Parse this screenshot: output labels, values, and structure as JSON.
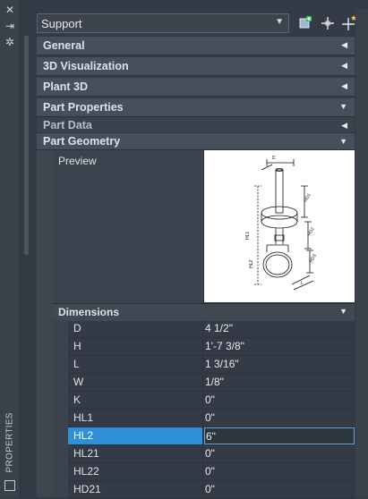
{
  "palette": {
    "title": "PROPERTIES",
    "close_icon": "close-icon",
    "autohide_icon": "auto-hide-icon",
    "settings_icon": "gear-icon"
  },
  "selector": {
    "value": "Support",
    "tools": [
      "quick-select-icon",
      "select-objects-icon",
      "toggle-pickadd-icon"
    ]
  },
  "sections": {
    "general": "General",
    "visualization": "3D Visualization",
    "plant": "Plant 3D",
    "part_properties": "Part Properties",
    "part_data": "Part Data",
    "part_geometry": "Part Geometry"
  },
  "geometry": {
    "preview_label": "Preview",
    "dimensions_label": "Dimensions"
  },
  "dimensions": [
    {
      "name": "D",
      "value": "4 1/2\""
    },
    {
      "name": "H",
      "value": "1'-7 3/8\""
    },
    {
      "name": "L",
      "value": "1 3/16\""
    },
    {
      "name": "W",
      "value": "1/8\""
    },
    {
      "name": "K",
      "value": "0\""
    },
    {
      "name": "HL1",
      "value": "0\""
    },
    {
      "name": "HL2",
      "value": "6\""
    },
    {
      "name": "HL21",
      "value": "0\""
    },
    {
      "name": "HL22",
      "value": "0\""
    },
    {
      "name": "HD21",
      "value": "0\""
    }
  ],
  "colors": {
    "background": "#343b46",
    "selection": "#2f8fd9"
  }
}
